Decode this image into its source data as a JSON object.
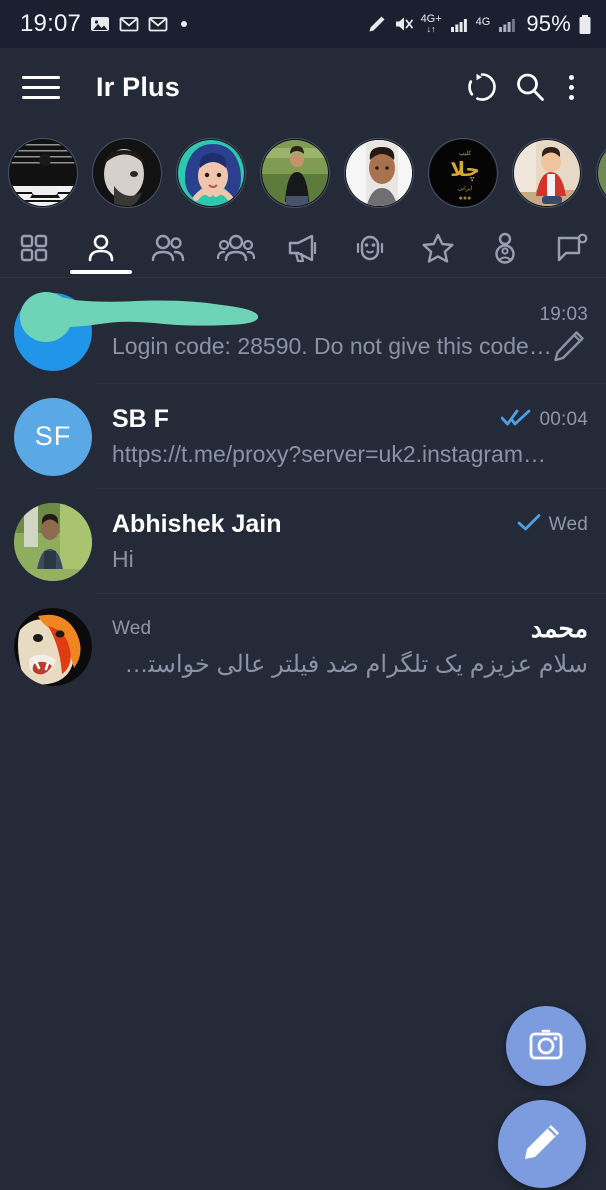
{
  "colors": {
    "background": "#242a38",
    "status_bar_bg": "#1b2030",
    "accent_blue": "#5aa9e6",
    "fab_blue": "#7d9ce0",
    "check_blue": "#4ea1e0",
    "secondary_text": "#8a93a5",
    "redaction_green": "#6fd3b8"
  },
  "status_bar": {
    "time": "19:07",
    "left_icons": [
      "image-icon",
      "gmail-icon",
      "gmail-icon",
      "dot-indicator"
    ],
    "right_icons": [
      "pen-icon",
      "mute-icon",
      "4g-plus-signal-icon",
      "signal-bars-icon",
      "4g-signal-icon",
      "signal-bars-icon"
    ],
    "network_1_label": "4G+",
    "network_2_label": "4G",
    "battery_percent": "95%",
    "battery_icon": "battery-full-icon"
  },
  "app_bar": {
    "menu_icon": "hamburger-menu-icon",
    "title": "Ir Plus",
    "proxy_icon": "proxy-refresh-icon",
    "search_icon": "search-icon",
    "overflow_icon": "more-vertical-icon"
  },
  "stories": {
    "items": [
      {
        "name": "story-avatar-1",
        "kind": "photo-bw-person"
      },
      {
        "name": "story-avatar-2",
        "kind": "photo-bw-man"
      },
      {
        "name": "story-avatar-3",
        "kind": "photo-woman-blue-hair"
      },
      {
        "name": "story-avatar-4",
        "kind": "photo-man-field"
      },
      {
        "name": "story-avatar-5",
        "kind": "photo-man-white-bg"
      },
      {
        "name": "story-avatar-6",
        "kind": "logo-gold-calligraphy"
      },
      {
        "name": "story-avatar-7",
        "kind": "photo-child-red-jacket"
      },
      {
        "name": "story-avatar-8",
        "kind": "photo-partial"
      }
    ]
  },
  "tabs": {
    "items": [
      {
        "label": "All chats",
        "icon": "grid-icon",
        "selected": false
      },
      {
        "label": "Personal",
        "icon": "person-icon",
        "selected": true
      },
      {
        "label": "Contacts",
        "icon": "two-people-icon",
        "selected": false
      },
      {
        "label": "Groups",
        "icon": "group-icon",
        "selected": false
      },
      {
        "label": "Channels",
        "icon": "megaphone-icon",
        "selected": false
      },
      {
        "label": "Bots",
        "icon": "robot-icon",
        "selected": false
      },
      {
        "label": "Favorites",
        "icon": "star-icon",
        "selected": false
      },
      {
        "label": "Secret",
        "icon": "incognito-person-icon",
        "selected": false
      },
      {
        "label": "Unread",
        "icon": "chat-bubble-badge-icon",
        "selected": false
      }
    ]
  },
  "chats": [
    {
      "name": "",
      "name_redacted": true,
      "avatar_type": "redacted",
      "avatar_color": "#2196e8",
      "message": "Login code: 28590. Do not give this code…",
      "time": "19:03",
      "status_icon": "none",
      "draft_icon": "pencil-icon",
      "rtl": false
    },
    {
      "name": "SB F",
      "name_redacted": false,
      "avatar_type": "initials",
      "avatar_initials": "SF",
      "avatar_color": "#5aa9e6",
      "message": "https://t.me/proxy?server=uk2.instagram…",
      "time": "00:04",
      "status_icon": "double-check-icon",
      "draft_icon": "none",
      "rtl": false
    },
    {
      "name": "Abhishek Jain",
      "name_redacted": false,
      "avatar_type": "photo",
      "avatar_photo": "person-outdoors",
      "message": "Hi",
      "time": "Wed",
      "status_icon": "single-check-icon",
      "draft_icon": "none",
      "rtl": false
    },
    {
      "name": "محمد",
      "name_redacted": false,
      "avatar_type": "photo",
      "avatar_photo": "leopard",
      "message": "سلام عزیزم  یک تلگرام ضد فیلتر عالی خواستم مع…",
      "time": "Wed",
      "status_icon": "none",
      "draft_icon": "none",
      "rtl": true
    }
  ],
  "fabs": {
    "camera": {
      "label": "Camera",
      "icon": "camera-icon"
    },
    "compose": {
      "label": "New message",
      "icon": "pencil-compose-icon"
    }
  }
}
